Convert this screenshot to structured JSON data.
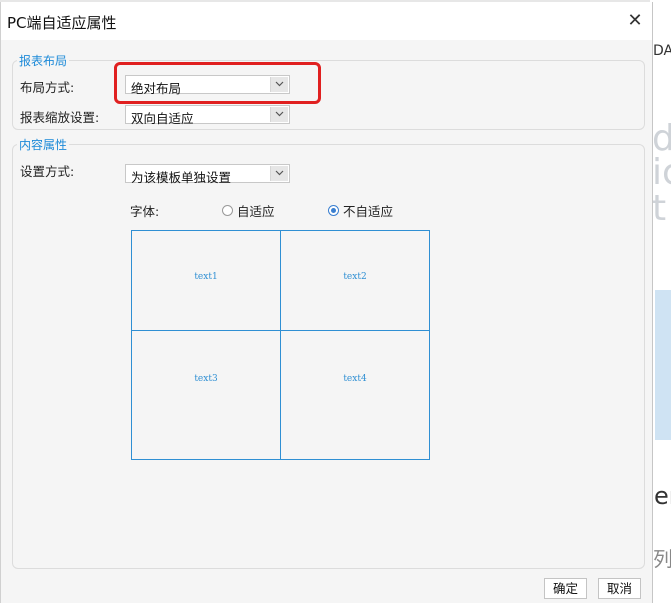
{
  "background": {
    "right_text_da": "DA",
    "right_text_er": "er",
    "right_text_lie": "列",
    "right_glyphs": [
      "de",
      "ic",
      "t"
    ]
  },
  "dialog": {
    "title": "PC端自适应属性",
    "close_symbol": "✕"
  },
  "report_layout": {
    "group_title": "报表布局",
    "layout_mode_label": "布局方式:",
    "layout_mode_value": "绝对布局",
    "zoom_label": "报表缩放设置:",
    "zoom_value": "双向自适应"
  },
  "content_props": {
    "group_title": "内容属性",
    "setting_label": "设置方式:",
    "setting_value": "为该模板单独设置",
    "font_label": "字体:",
    "font_options": [
      {
        "label": "自适应",
        "selected": false
      },
      {
        "label": "不自适应",
        "selected": true
      }
    ],
    "preview_cells": [
      "text1",
      "text2",
      "text3",
      "text4"
    ]
  },
  "footer": {
    "ok_label": "确定",
    "cancel_label": "取消"
  },
  "colors": {
    "accent": "#1d8ad8",
    "highlight_border": "#e02020",
    "preview_border": "#2f8fd3"
  }
}
